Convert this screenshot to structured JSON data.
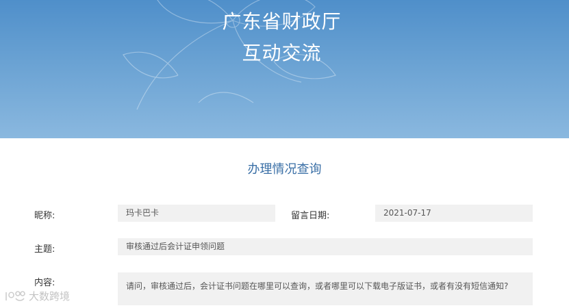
{
  "banner": {
    "title_line1": "广东省财政厅",
    "title_line2": "互动交流"
  },
  "section": {
    "title": "办理情况查询"
  },
  "form": {
    "nickname_label": "昵称:",
    "nickname_value": "玛卡巴卡",
    "date_label": "留言日期:",
    "date_value": "2021-07-17",
    "subject_label": "主题:",
    "subject_value": "审核通过后会计证申领问题",
    "content_label": "内容:",
    "content_value": "请问，审核通过后，会计证书问题在哪里可以查询，或者哪里可以下载电子版证书，或者有没有短信通知?"
  },
  "watermark": {
    "text": "大数跨境"
  },
  "colors": {
    "banner_top": "#4f8fca",
    "banner_bottom": "#8ab8df",
    "section_title": "#3a6fa6",
    "field_bg": "#f1f1f1"
  }
}
